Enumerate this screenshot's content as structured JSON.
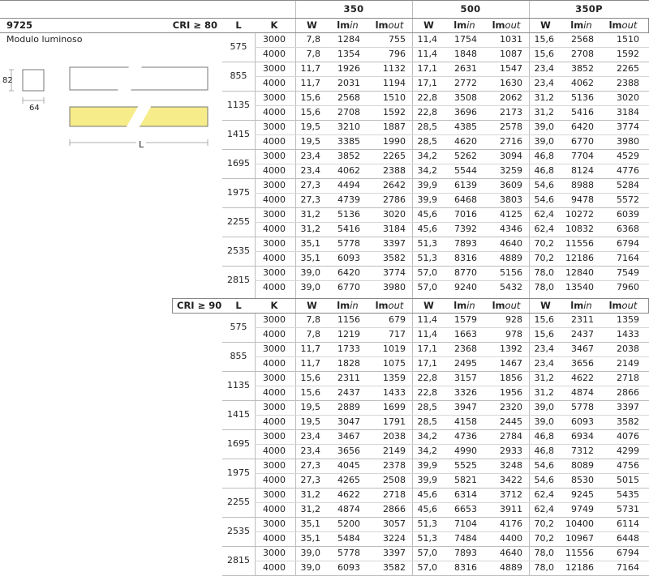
{
  "product": {
    "code": "9725",
    "name": "Modulo luminoso"
  },
  "drawing": {
    "height_label": "82",
    "width_label": "64",
    "length_label": "L",
    "accent_color": "#f7ec8a"
  },
  "header": {
    "groups": [
      "350",
      "500",
      "350P"
    ],
    "col_L": "L",
    "col_K": "K",
    "col_W": "W",
    "col_lmin_prefix": "lm",
    "col_lmin_suffix": "in",
    "col_lmout_prefix": "lm",
    "col_lmout_suffix": "out"
  },
  "sections": [
    {
      "cri_label": "CRI ≥ 80",
      "rows": [
        {
          "L": "575",
          "K": [
            "3000",
            "4000"
          ],
          "v": [
            [
              "7,8",
              "1284",
              "755",
              "11,4",
              "1754",
              "1031",
              "15,6",
              "2568",
              "1510"
            ],
            [
              "7,8",
              "1354",
              "796",
              "11,4",
              "1848",
              "1087",
              "15,6",
              "2708",
              "1592"
            ]
          ]
        },
        {
          "L": "855",
          "K": [
            "3000",
            "4000"
          ],
          "v": [
            [
              "11,7",
              "1926",
              "1132",
              "17,1",
              "2631",
              "1547",
              "23,4",
              "3852",
              "2265"
            ],
            [
              "11,7",
              "2031",
              "1194",
              "17,1",
              "2772",
              "1630",
              "23,4",
              "4062",
              "2388"
            ]
          ]
        },
        {
          "L": "1135",
          "K": [
            "3000",
            "4000"
          ],
          "v": [
            [
              "15,6",
              "2568",
              "1510",
              "22,8",
              "3508",
              "2062",
              "31,2",
              "5136",
              "3020"
            ],
            [
              "15,6",
              "2708",
              "1592",
              "22,8",
              "3696",
              "2173",
              "31,2",
              "5416",
              "3184"
            ]
          ]
        },
        {
          "L": "1415",
          "K": [
            "3000",
            "4000"
          ],
          "v": [
            [
              "19,5",
              "3210",
              "1887",
              "28,5",
              "4385",
              "2578",
              "39,0",
              "6420",
              "3774"
            ],
            [
              "19,5",
              "3385",
              "1990",
              "28,5",
              "4620",
              "2716",
              "39,0",
              "6770",
              "3980"
            ]
          ]
        },
        {
          "L": "1695",
          "K": [
            "3000",
            "4000"
          ],
          "v": [
            [
              "23,4",
              "3852",
              "2265",
              "34,2",
              "5262",
              "3094",
              "46,8",
              "7704",
              "4529"
            ],
            [
              "23,4",
              "4062",
              "2388",
              "34,2",
              "5544",
              "3259",
              "46,8",
              "8124",
              "4776"
            ]
          ]
        },
        {
          "L": "1975",
          "K": [
            "3000",
            "4000"
          ],
          "v": [
            [
              "27,3",
              "4494",
              "2642",
              "39,9",
              "6139",
              "3609",
              "54,6",
              "8988",
              "5284"
            ],
            [
              "27,3",
              "4739",
              "2786",
              "39,9",
              "6468",
              "3803",
              "54,6",
              "9478",
              "5572"
            ]
          ]
        },
        {
          "L": "2255",
          "K": [
            "3000",
            "4000"
          ],
          "v": [
            [
              "31,2",
              "5136",
              "3020",
              "45,6",
              "7016",
              "4125",
              "62,4",
              "10272",
              "6039"
            ],
            [
              "31,2",
              "5416",
              "3184",
              "45,6",
              "7392",
              "4346",
              "62,4",
              "10832",
              "6368"
            ]
          ]
        },
        {
          "L": "2535",
          "K": [
            "3000",
            "4000"
          ],
          "v": [
            [
              "35,1",
              "5778",
              "3397",
              "51,3",
              "7893",
              "4640",
              "70,2",
              "11556",
              "6794"
            ],
            [
              "35,1",
              "6093",
              "3582",
              "51,3",
              "8316",
              "4889",
              "70,2",
              "12186",
              "7164"
            ]
          ]
        },
        {
          "L": "2815",
          "K": [
            "3000",
            "4000"
          ],
          "v": [
            [
              "39,0",
              "6420",
              "3774",
              "57,0",
              "8770",
              "5156",
              "78,0",
              "12840",
              "7549"
            ],
            [
              "39,0",
              "6770",
              "3980",
              "57,0",
              "9240",
              "5432",
              "78,0",
              "13540",
              "7960"
            ]
          ]
        }
      ]
    },
    {
      "cri_label": "CRI ≥ 90",
      "rows": [
        {
          "L": "575",
          "K": [
            "3000",
            "4000"
          ],
          "v": [
            [
              "7,8",
              "1156",
              "679",
              "11,4",
              "1579",
              "928",
              "15,6",
              "2311",
              "1359"
            ],
            [
              "7,8",
              "1219",
              "717",
              "11,4",
              "1663",
              "978",
              "15,6",
              "2437",
              "1433"
            ]
          ]
        },
        {
          "L": "855",
          "K": [
            "3000",
            "4000"
          ],
          "v": [
            [
              "11,7",
              "1733",
              "1019",
              "17,1",
              "2368",
              "1392",
              "23,4",
              "3467",
              "2038"
            ],
            [
              "11,7",
              "1828",
              "1075",
              "17,1",
              "2495",
              "1467",
              "23,4",
              "3656",
              "2149"
            ]
          ]
        },
        {
          "L": "1135",
          "K": [
            "3000",
            "4000"
          ],
          "v": [
            [
              "15,6",
              "2311",
              "1359",
              "22,8",
              "3157",
              "1856",
              "31,2",
              "4622",
              "2718"
            ],
            [
              "15,6",
              "2437",
              "1433",
              "22,8",
              "3326",
              "1956",
              "31,2",
              "4874",
              "2866"
            ]
          ]
        },
        {
          "L": "1415",
          "K": [
            "3000",
            "4000"
          ],
          "v": [
            [
              "19,5",
              "2889",
              "1699",
              "28,5",
              "3947",
              "2320",
              "39,0",
              "5778",
              "3397"
            ],
            [
              "19,5",
              "3047",
              "1791",
              "28,5",
              "4158",
              "2445",
              "39,0",
              "6093",
              "3582"
            ]
          ]
        },
        {
          "L": "1695",
          "K": [
            "3000",
            "4000"
          ],
          "v": [
            [
              "23,4",
              "3467",
              "2038",
              "34,2",
              "4736",
              "2784",
              "46,8",
              "6934",
              "4076"
            ],
            [
              "23,4",
              "3656",
              "2149",
              "34,2",
              "4990",
              "2933",
              "46,8",
              "7312",
              "4299"
            ]
          ]
        },
        {
          "L": "1975",
          "K": [
            "3000",
            "4000"
          ],
          "v": [
            [
              "27,3",
              "4045",
              "2378",
              "39,9",
              "5525",
              "3248",
              "54,6",
              "8089",
              "4756"
            ],
            [
              "27,3",
              "4265",
              "2508",
              "39,9",
              "5821",
              "3422",
              "54,6",
              "8530",
              "5015"
            ]
          ]
        },
        {
          "L": "2255",
          "K": [
            "3000",
            "4000"
          ],
          "v": [
            [
              "31,2",
              "4622",
              "2718",
              "45,6",
              "6314",
              "3712",
              "62,4",
              "9245",
              "5435"
            ],
            [
              "31,2",
              "4874",
              "2866",
              "45,6",
              "6653",
              "3911",
              "62,4",
              "9749",
              "5731"
            ]
          ]
        },
        {
          "L": "2535",
          "K": [
            "3000",
            "4000"
          ],
          "v": [
            [
              "35,1",
              "5200",
              "3057",
              "51,3",
              "7104",
              "4176",
              "70,2",
              "10400",
              "6114"
            ],
            [
              "35,1",
              "5484",
              "3224",
              "51,3",
              "7484",
              "4400",
              "70,2",
              "10967",
              "6448"
            ]
          ]
        },
        {
          "L": "2815",
          "K": [
            "3000",
            "4000"
          ],
          "v": [
            [
              "39,0",
              "5778",
              "3397",
              "57,0",
              "7893",
              "4640",
              "78,0",
              "11556",
              "6794"
            ],
            [
              "39,0",
              "6093",
              "3582",
              "57,0",
              "8316",
              "4889",
              "78,0",
              "12186",
              "7164"
            ]
          ]
        }
      ]
    }
  ]
}
